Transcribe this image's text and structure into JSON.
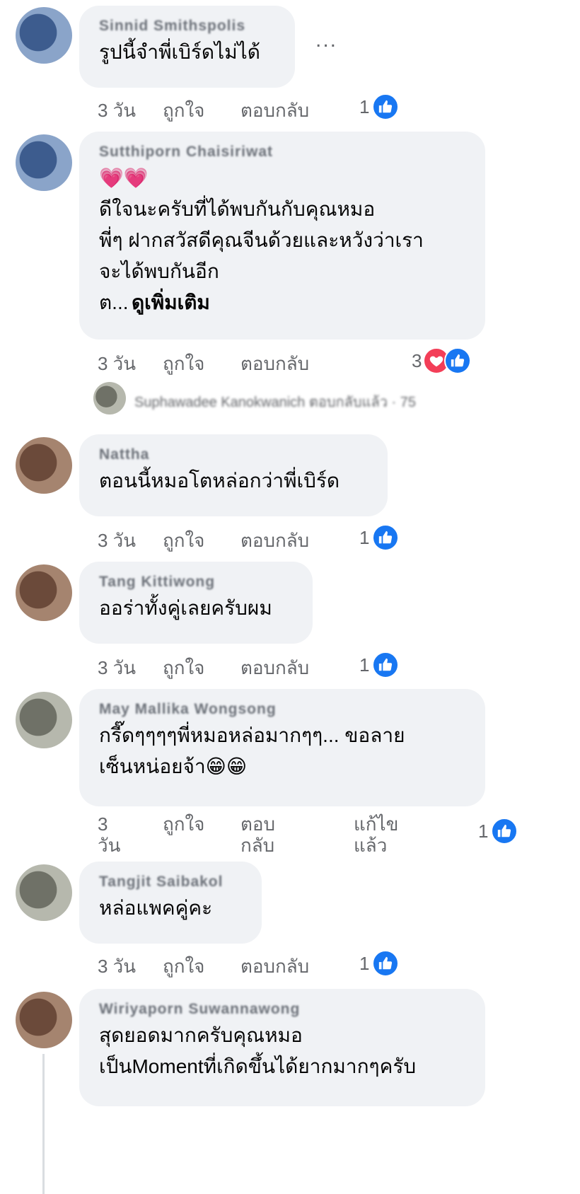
{
  "comments": [
    {
      "name": "Sinnid Smithspolis",
      "text": "รูปนี้จำพี่เบิร์ดไม่ได้",
      "time": "3 วัน",
      "like": "ถูกใจ",
      "reply": "ตอบกลับ",
      "reaction_count": "1",
      "reactions": [
        "like"
      ]
    },
    {
      "name": "Sutthiporn Chaisiriwat",
      "emoji": "💗💗",
      "text": "ดีใจนะครับที่ได้พบกันกับคุณหมอ\nพี่ๆ ฝากสวัสดีคุณจีนด้วยและหวังว่าเรา\nจะได้พบกันอีก\nต...",
      "see_more": "ดูเพิ่มเติม",
      "time": "3 วัน",
      "like": "ถูกใจ",
      "reply": "ตอบกลับ",
      "reaction_count": "3",
      "reactions": [
        "love",
        "like"
      ]
    },
    {
      "name": "Nattha",
      "text": "ตอนนี้หมอโตหล่อกว่าพี่เบิร์ด",
      "time": "3 วัน",
      "like": "ถูกใจ",
      "reply": "ตอบกลับ",
      "reaction_count": "1",
      "reactions": [
        "like"
      ]
    },
    {
      "name": "Tang Kittiwong",
      "text": "ออร่าทั้งคู่เลยครับผม",
      "time": "3 วัน",
      "like": "ถูกใจ",
      "reply": "ตอบกลับ",
      "reaction_count": "1",
      "reactions": [
        "like"
      ]
    },
    {
      "name": "May Mallika Wongsong",
      "text": "กรี๊ดๆๆๆๆพี่หมอหล่อมากๆๆ... ขอลาย\nเซ็นหน่อยจ้า😁😁",
      "time_line1": "3",
      "time_line2": "วัน",
      "like": "ถูกใจ",
      "reply_line1": "ตอบ",
      "reply_line2": "กลับ",
      "edited_line1": "แก้ไข",
      "edited_line2": "แล้ว",
      "reaction_count": "1",
      "reactions": [
        "like"
      ]
    },
    {
      "name": "Tangjit Saibakol",
      "text": "หล่อแพคคู่คะ",
      "time": "3 วัน",
      "like": "ถูกใจ",
      "reply": "ตอบกลับ",
      "reaction_count": "1",
      "reactions": [
        "like"
      ]
    },
    {
      "name": "Wiriyaporn Suwannawong",
      "text": "สุดยอดมากครับคุณหมอ\nเป็นMomentที่เกิดขึ้นได้ยากมากๆครับ"
    }
  ],
  "hidden_reply_link": "Suphawadee Kanokwanich ตอบกลับแล้ว · 75",
  "more_label": "..."
}
